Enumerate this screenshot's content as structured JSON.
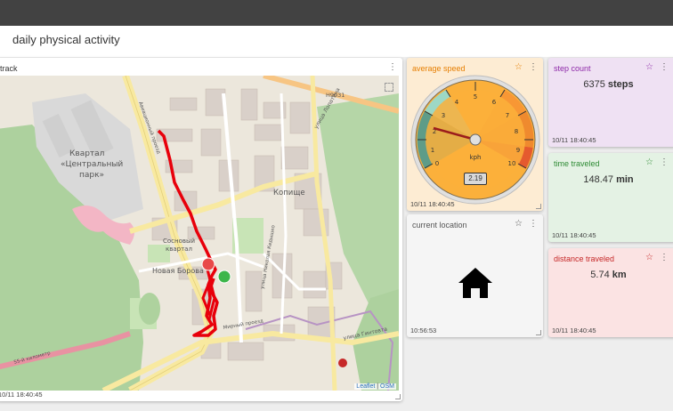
{
  "header": {
    "title": "daily physical activity"
  },
  "track": {
    "title": "track",
    "timestamp": "10/11 18:40:45",
    "attribution_leaflet": "Leaflet",
    "attribution_sep": " | ",
    "attribution_osm": "OSM",
    "map_labels": {
      "kvartal_central": "Квартал",
      "central_park": "«Центральный",
      "central_park2": "парк»",
      "kopische": "Копище",
      "sosnovy": "Сосновый",
      "sosnovy2": "квартал",
      "novaya_borovaya": "Новая Борова",
      "h9031": "H9031",
      "street_gintovta": "улица Гинтовта",
      "street_lopatina": "улица Лопатина",
      "street_nikolaya": "улица Николая Кедышко",
      "street_aviation": "Авиационный проезд",
      "mkad": "55-й километр",
      "skhody": "Мирный проезд"
    }
  },
  "average_speed": {
    "title": "average speed",
    "timestamp": "10/11 18:40:45",
    "value": "2.19",
    "unit": "kph",
    "ticks": [
      "0",
      "1",
      "2",
      "3",
      "4",
      "5",
      "6",
      "7",
      "8",
      "9",
      "10"
    ]
  },
  "step_count": {
    "title": "step count",
    "value": "6375",
    "unit": "steps",
    "timestamp": "10/11 18:40:45"
  },
  "time_traveled": {
    "title": "time traveled",
    "value": "148.47",
    "unit": "min",
    "timestamp": "10/11 18:40:45"
  },
  "current_location": {
    "title": "current location",
    "timestamp": "10:56:53"
  },
  "distance_traveled": {
    "title": "distance traveled",
    "value": "5.74",
    "unit": "km",
    "timestamp": "10/11 18:40:45"
  },
  "colors": {
    "topbar": "#424242",
    "speed_bg": "#fdecd3",
    "speed_title": "#e67e00",
    "step_bg": "#efe1f3",
    "step_title": "#8e2aa8",
    "time_bg": "#e4f2e4",
    "time_title": "#2e8b34",
    "dist_bg": "#fbe3e3",
    "dist_title": "#c62828",
    "track_red": "#e8000b"
  }
}
